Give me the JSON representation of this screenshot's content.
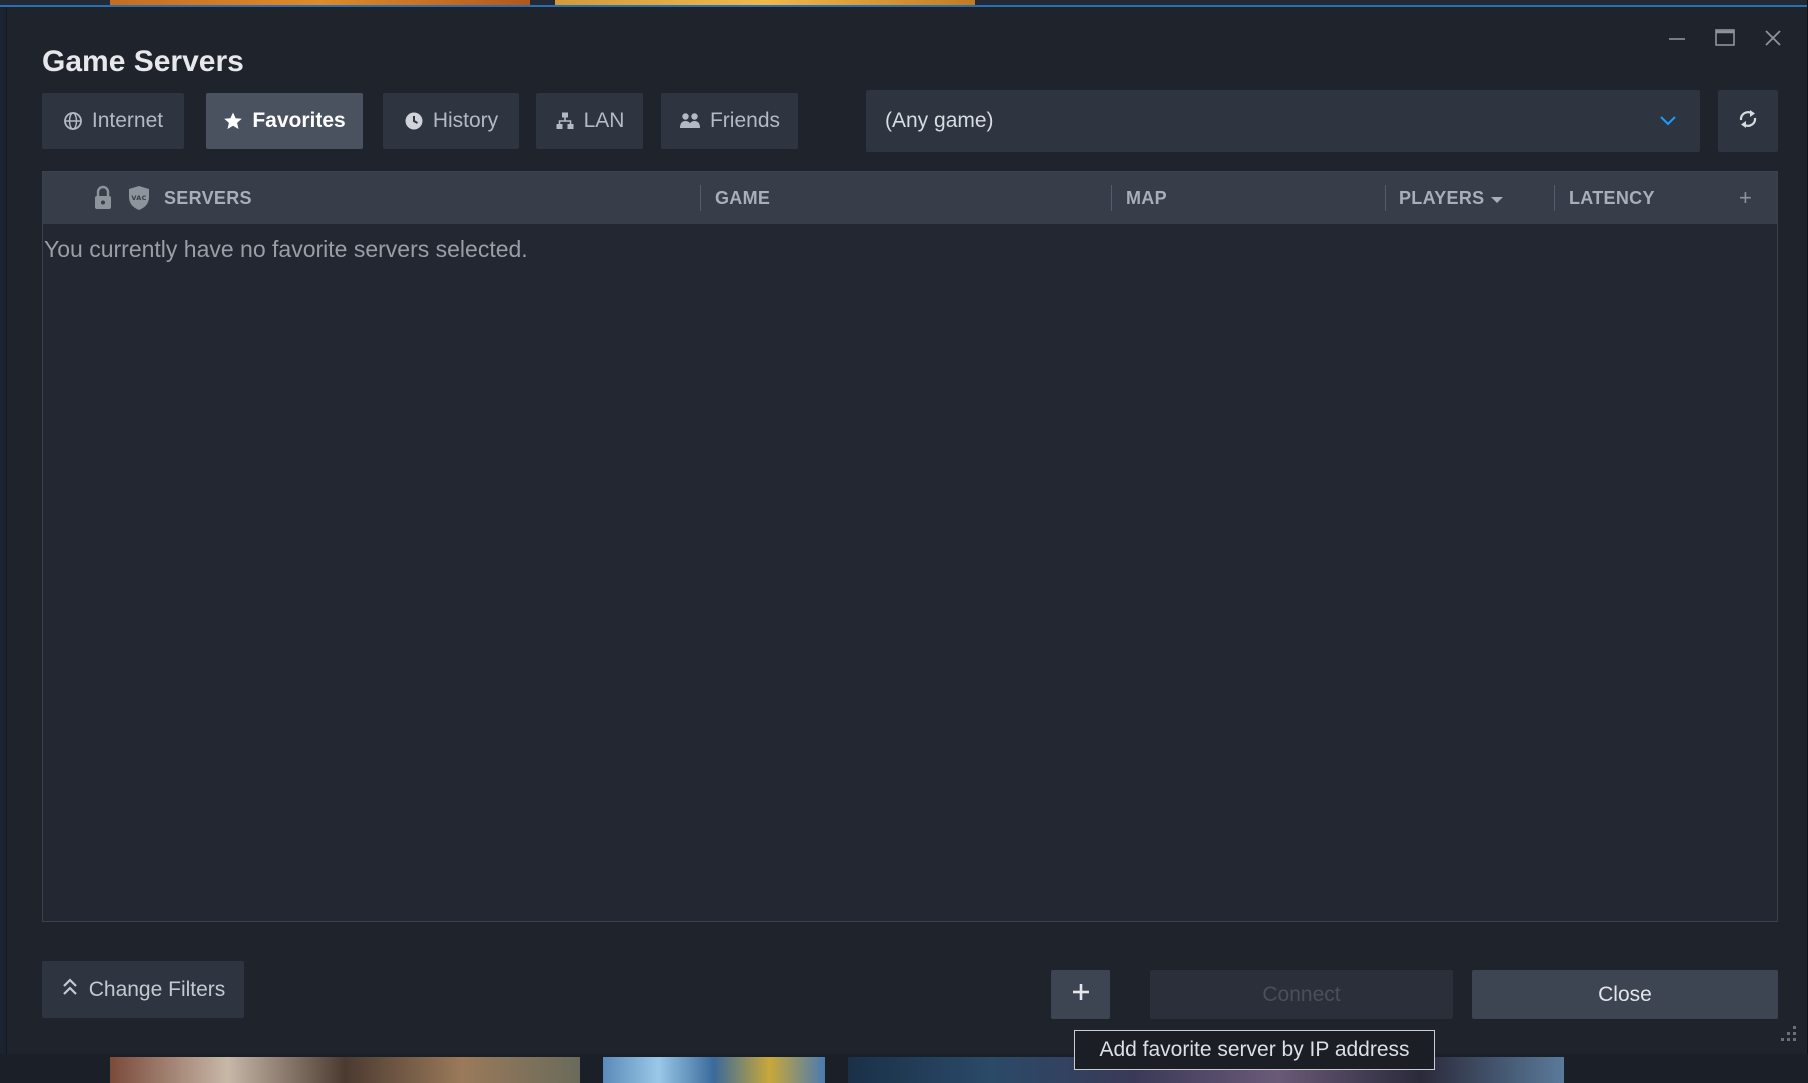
{
  "window": {
    "title": "Game Servers",
    "controls": [
      "minimize-icon",
      "maximize-icon",
      "close-icon"
    ]
  },
  "tabs": [
    {
      "label": "Internet",
      "icon": "globe-icon",
      "active": false
    },
    {
      "label": "Favorites",
      "icon": "star-icon",
      "active": true
    },
    {
      "label": "History",
      "icon": "clock-icon",
      "active": false
    },
    {
      "label": "LAN",
      "icon": "network-icon",
      "active": false
    },
    {
      "label": "Friends",
      "icon": "people-icon",
      "active": false
    }
  ],
  "game_filter": {
    "value": "(Any game)",
    "icon": "chevron-down-icon"
  },
  "refresh": {
    "icon": "refresh-icon"
  },
  "table": {
    "columns": {
      "password_icon": "lock-icon",
      "vac_icon": "vac-shield-icon",
      "servers": "SERVERS",
      "game": "GAME",
      "map": "MAP",
      "players": "PLAYERS",
      "latency": "LATENCY",
      "add_column": "+"
    },
    "sorted_by": "PLAYERS",
    "empty_message": "You currently have no favorite servers selected."
  },
  "footer": {
    "change_filters": "Change Filters",
    "add_button_icon": "plus-icon",
    "connect": "Connect",
    "close": "Close",
    "tooltip": "Add favorite server by IP address"
  },
  "colors": {
    "window_bg": "#1f232c",
    "button_bg": "#2e3440",
    "active_tab_bg": "#4a5260",
    "accent_blue": "#1a9fff"
  }
}
